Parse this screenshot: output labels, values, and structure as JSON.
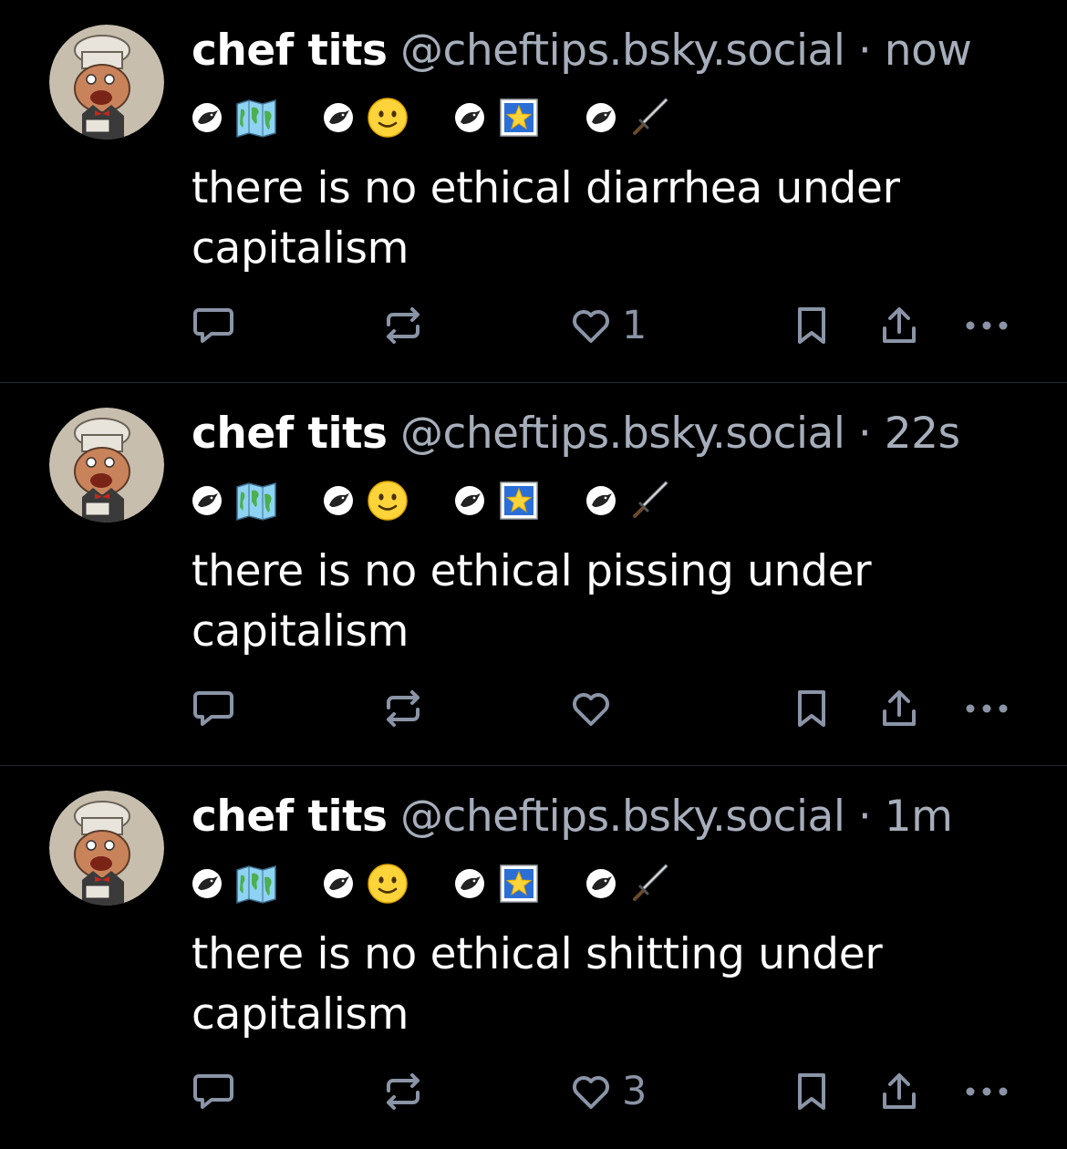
{
  "colors": {
    "background": "#000000",
    "text": "#ffffff",
    "muted": "#a6aebb",
    "icon": "#8a94a6",
    "divider": "#262b31"
  },
  "posts": [
    {
      "display_name": "chef tits",
      "handle": "@cheftips.bsky.social",
      "separator": "·",
      "time": "now",
      "badges": [
        "map-emoji",
        "smiley-emoji",
        "star-picture-emoji",
        "dagger-emoji"
      ],
      "text": "there is no ethical diarrhea under capitalism",
      "like_count": "1"
    },
    {
      "display_name": "chef tits",
      "handle": "@cheftips.bsky.social",
      "separator": "·",
      "time": "22s",
      "badges": [
        "map-emoji",
        "smiley-emoji",
        "star-picture-emoji",
        "dagger-emoji"
      ],
      "text": "there is no ethical pissing under capitalism",
      "like_count": ""
    },
    {
      "display_name": "chef tits",
      "handle": "@cheftips.bsky.social",
      "separator": "·",
      "time": "1m",
      "badges": [
        "map-emoji",
        "smiley-emoji",
        "star-picture-emoji",
        "dagger-emoji"
      ],
      "text": "there is no ethical shitting under capitalism",
      "like_count": "3"
    }
  ]
}
